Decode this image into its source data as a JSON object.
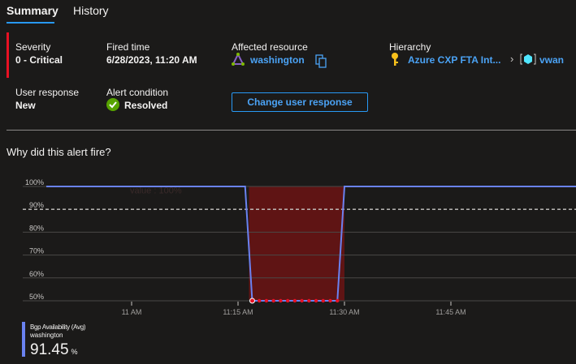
{
  "tabs": [
    {
      "label": "Summary",
      "active": true
    },
    {
      "label": "History",
      "active": false
    }
  ],
  "summary": {
    "severity": {
      "label": "Severity",
      "value": "0 - Critical"
    },
    "fired_time": {
      "label": "Fired time",
      "value": "6/28/2023, 11:20 AM"
    },
    "affected_resource": {
      "label": "Affected resource",
      "value": "washington",
      "icon": "network-triangle-icon"
    },
    "hierarchy": {
      "label": "Hierarchy",
      "items": [
        "Azure CXP FTA Int...",
        "vwan"
      ]
    },
    "user_response": {
      "label": "User response",
      "value": "New"
    },
    "alert_condition": {
      "label": "Alert condition",
      "value": "Resolved"
    },
    "change_button": "Change user response"
  },
  "section_title": "Why did this alert fire?",
  "colors": {
    "accent": "#2899f5",
    "severity": "#e81123",
    "series": "#6a82f0",
    "alert_region": "#6b1414"
  },
  "chart_data": {
    "type": "line",
    "ylim": [
      50,
      100
    ],
    "y_ticks": [
      "100%",
      "90%",
      "80%",
      "70%",
      "60%",
      "50%"
    ],
    "x_ticks": [
      "11 AM",
      "11:15 AM",
      "11:30 AM",
      "11:45 AM"
    ],
    "threshold": 90,
    "tooltip_ghost": "value : 100%",
    "x_range": [
      "10:48",
      "12:02"
    ],
    "series": [
      {
        "name": "Bgp Availability (Avg)",
        "points": [
          [
            "10:48",
            100
          ],
          [
            "11:16",
            100
          ],
          [
            "11:17",
            50
          ],
          [
            "11:18",
            50
          ],
          [
            "11:19",
            50
          ],
          [
            "11:20",
            50
          ],
          [
            "11:21",
            50
          ],
          [
            "11:22",
            50
          ],
          [
            "11:23",
            50
          ],
          [
            "11:24",
            50
          ],
          [
            "11:25",
            50
          ],
          [
            "11:26",
            50
          ],
          [
            "11:27",
            50
          ],
          [
            "11:28",
            50
          ],
          [
            "11:29",
            50
          ],
          [
            "11:30",
            100
          ],
          [
            "12:02",
            100
          ]
        ]
      }
    ],
    "alert_region": [
      "11:17",
      "11:30"
    ],
    "legend": {
      "metric": "Bgp Availability (Avg)",
      "resource": "washington",
      "value": "91.45",
      "unit": "%"
    }
  }
}
